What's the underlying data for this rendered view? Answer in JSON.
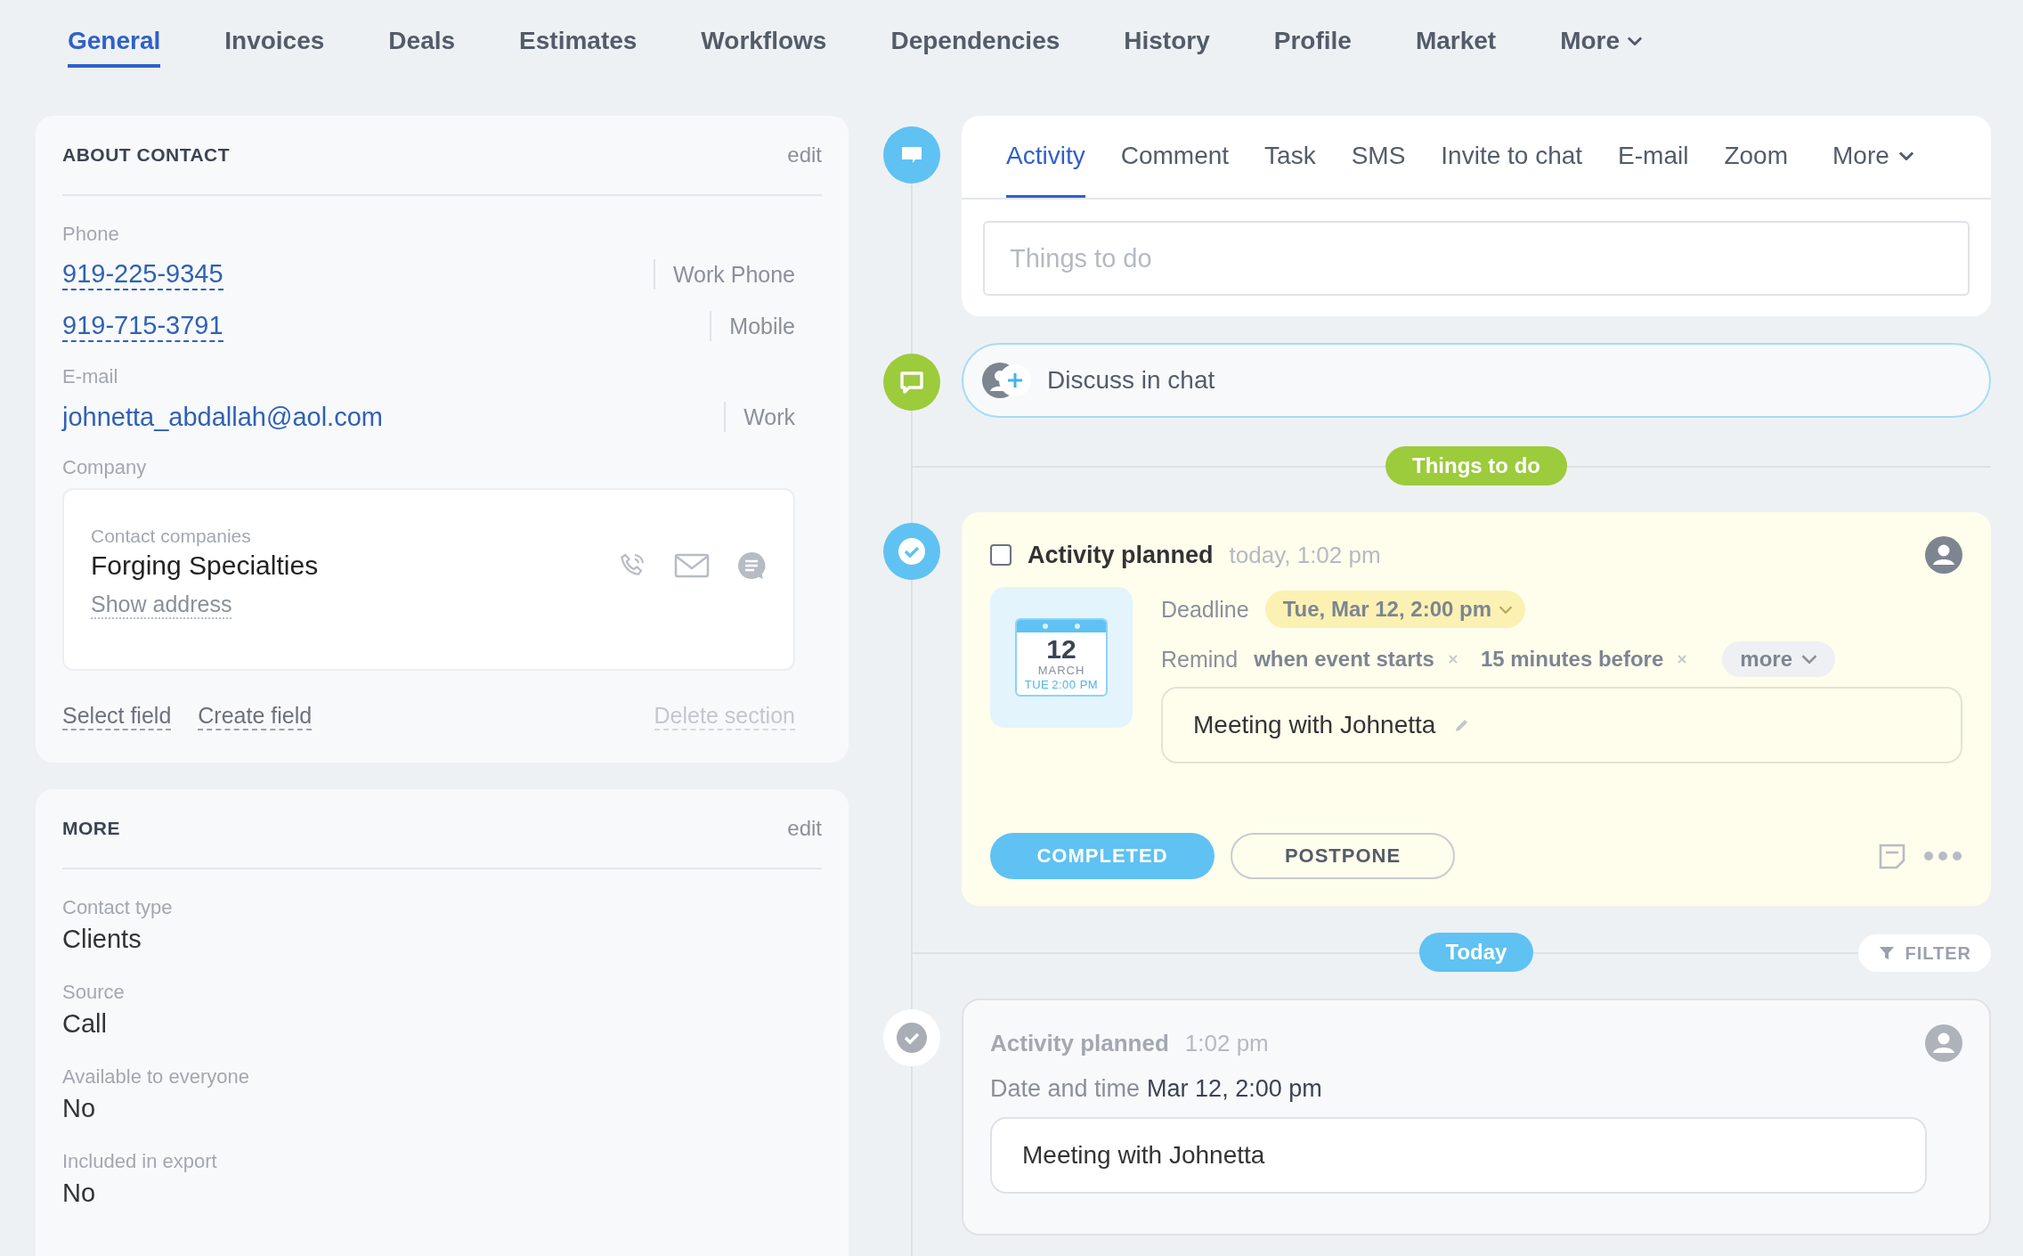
{
  "top_tabs": [
    {
      "label": "General",
      "selected": true,
      "kind": "tab"
    },
    {
      "label": "Invoices",
      "selected": false,
      "kind": "tab"
    },
    {
      "label": "Deals",
      "selected": false,
      "kind": "tab"
    },
    {
      "label": "Estimates",
      "selected": false,
      "kind": "tab"
    },
    {
      "label": "Workflows",
      "selected": false,
      "kind": "tab"
    },
    {
      "label": "Dependencies",
      "selected": false,
      "kind": "tab"
    },
    {
      "label": "History",
      "selected": false,
      "kind": "tab"
    },
    {
      "label": "Profile",
      "selected": false,
      "kind": "tab"
    },
    {
      "label": "Market",
      "selected": false,
      "kind": "tab"
    },
    {
      "label": "More",
      "selected": false,
      "kind": "dropdown"
    }
  ],
  "about_contact": {
    "title": "ABOUT CONTACT",
    "edit": "edit",
    "phone_label": "Phone",
    "phones": [
      {
        "number": "919-225-9345",
        "type": "Work Phone"
      },
      {
        "number": "919-715-3791",
        "type": "Mobile"
      }
    ],
    "email_label": "E-mail",
    "emails": [
      {
        "address": "johnetta_abdallah@aol.com",
        "type": "Work"
      }
    ],
    "company_label": "Company",
    "company": {
      "caption": "Contact companies",
      "name": "Forging Specialties",
      "link": "Show address"
    },
    "actions": [
      "Select field",
      "Create field"
    ],
    "delete": {
      "label": "Delete section",
      "disabled": true
    }
  },
  "more_section": {
    "title": "MORE",
    "edit": "edit",
    "fields": [
      {
        "label": "Contact type",
        "value": "Clients"
      },
      {
        "label": "Source",
        "value": "Call"
      },
      {
        "label": "Available to everyone",
        "value": "No"
      },
      {
        "label": "Included in export",
        "value": "No"
      }
    ]
  },
  "composer": {
    "tabs": [
      {
        "label": "Activity",
        "selected": true,
        "kind": "tab"
      },
      {
        "label": "Comment",
        "selected": false,
        "kind": "tab"
      },
      {
        "label": "Task",
        "selected": false,
        "kind": "tab"
      },
      {
        "label": "SMS",
        "selected": false,
        "kind": "tab"
      },
      {
        "label": "Invite to chat",
        "selected": false,
        "kind": "tab"
      },
      {
        "label": "E-mail",
        "selected": false,
        "kind": "tab"
      },
      {
        "label": "Zoom",
        "selected": false,
        "kind": "tab"
      },
      {
        "label": "More",
        "selected": false,
        "kind": "dropdown"
      }
    ],
    "placeholder": "Things to do"
  },
  "chat": {
    "label": "Discuss in chat"
  },
  "things_divider": "Things to do",
  "planned_activity": {
    "checked": false,
    "title": "Activity planned",
    "time": "today, 1:02 pm",
    "calendar": {
      "day": "12",
      "month": "MARCH",
      "weekday": "TUE",
      "time": "2:00 PM"
    },
    "deadline_label": "Deadline",
    "deadline": "Tue, Mar 12, 2:00 pm",
    "remind_label": "Remind",
    "reminders": [
      "when event starts",
      "15 minutes before"
    ],
    "more": "more",
    "note": "Meeting with Johnetta",
    "buttons": [
      {
        "label": "COMPLETED",
        "kind": "primary"
      },
      {
        "label": "POSTPONE",
        "kind": "outline"
      }
    ]
  },
  "today_divider": "Today",
  "filter": "FILTER",
  "history_item": {
    "title": "Activity planned",
    "time": "1:02 pm",
    "date_label": "Date and time",
    "date": "Mar 12, 2:00 pm",
    "note": "Meeting with Johnetta"
  }
}
